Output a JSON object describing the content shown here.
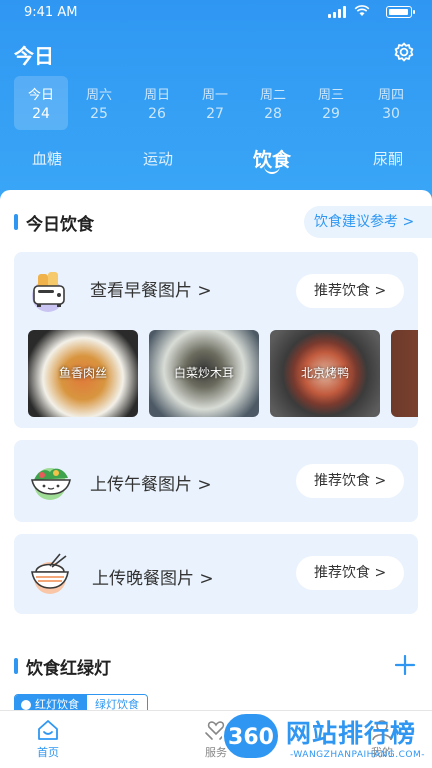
{
  "status_bar": {
    "time": "9:41 AM"
  },
  "header": {
    "title": "今日",
    "settings_icon": "gear-icon"
  },
  "date_strip": [
    {
      "weekday": "今日",
      "day": "24",
      "active": true
    },
    {
      "weekday": "周六",
      "day": "25"
    },
    {
      "weekday": "周日",
      "day": "26"
    },
    {
      "weekday": "周一",
      "day": "27"
    },
    {
      "weekday": "周二",
      "day": "28"
    },
    {
      "weekday": "周三",
      "day": "29"
    },
    {
      "weekday": "周四",
      "day": "30"
    }
  ],
  "categories": [
    {
      "label": "血糖"
    },
    {
      "label": "运动"
    },
    {
      "label": "饮食",
      "active": true
    },
    {
      "label": "尿酮"
    }
  ],
  "today_diet": {
    "title": "今日饮食",
    "advice_link": "饮食建议参考 >",
    "breakfast": {
      "label": "查看早餐图片 >",
      "recommend": "推荐饮食 >",
      "photos": [
        {
          "caption": "鱼香肉丝"
        },
        {
          "caption": "白菜炒木耳"
        },
        {
          "caption": "北京烤鸭"
        }
      ]
    },
    "lunch": {
      "label": "上传午餐图片 >",
      "recommend": "推荐饮食 >"
    },
    "dinner": {
      "label": "上传晚餐图片 >",
      "recommend": "推荐饮食 >"
    }
  },
  "traffic_light": {
    "title": "饮食红绿灯",
    "add_icon": "plus-icon",
    "tabs": [
      {
        "label": "红灯饮食",
        "active": true
      },
      {
        "label": "绿灯饮食"
      }
    ]
  },
  "tab_bar": [
    {
      "label": "首页",
      "icon": "home-icon",
      "active": true
    },
    {
      "label": "服务",
      "icon": "service-icon"
    },
    {
      "label": "我的",
      "icon": "user-icon"
    }
  ],
  "watermark": {
    "badge": "360",
    "title": "网站排行榜",
    "subtitle": "-WANGZHANPAIHANG.COM-"
  },
  "colors": {
    "primary": "#2f97f2",
    "card_bg": "#eaf3fd"
  }
}
